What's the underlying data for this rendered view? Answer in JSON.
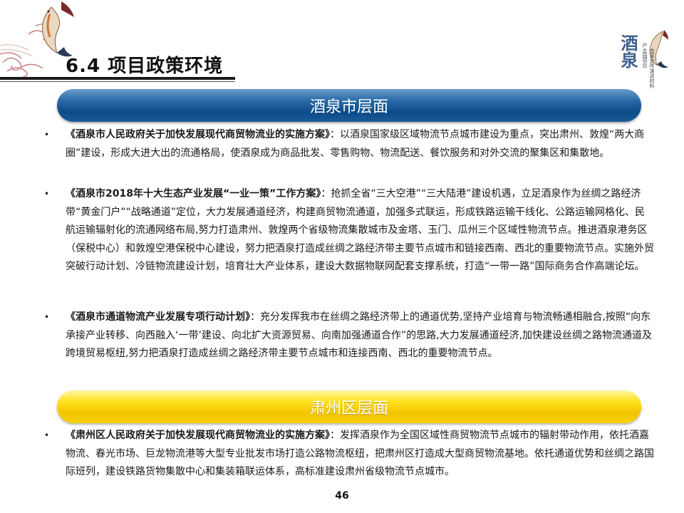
{
  "title": "6.4 项目政策环境",
  "logo": {
    "main": "酒泉",
    "sub_line1": "产业园项目",
    "sub_line2": "改革宣传演讲材料"
  },
  "section_city": "酒泉市层面",
  "section_district": "肃州区层面",
  "items": [
    {
      "head": "《酒泉市人民政府关于加快发展现代商贸物流业的实施方案》",
      "body": "：以酒泉国家级区域物流节点城市建设为重点，突出肃州、敦煌“两大商圈”建设，形成大进大出的流通格局，使酒泉成为商品批发、零售购物、物流配送、餐饮服务和对外交流的聚集区和集散地。"
    },
    {
      "head": "《酒泉市2018年十大生态产业发展“一业一策”工作方案》",
      "body": "：抢抓全省“三大空港”“三大陆港”建设机遇，立足酒泉作为丝绸之路经济带“黄金门户”“战略通道”定位，大力发展通道经济，构建商贸物流通道，加强多式联运，形成铁路运输干线化、公路运输网格化、民航运输辐射化的流通网络布局,努力打造肃州、敦煌两个省级物流集散城市及金塔、玉门、瓜州三个区域性物流节点。推进酒泉港务区（保税中心）和敦煌空港保税中心建设，努力把酒泉打造成丝绸之路经济带主要节点城市和链接西南、西北的重要物流节点。实施外贸突破行动计划、冷链物流建设计划，培育壮大产业体系，建设大数据物联网配套支撑系统，打造“一带一路”国际商务合作高端论坛。"
    },
    {
      "head": "《酒泉市通道物流产业发展专项行动计划》",
      "body": "：充分发挥我市在丝绸之路经济带上的通道优势,坚持产业培育与物流畅通相融合,按照“向东承接产业转移、向西融入‘一带’建设、向北扩大资源贸易、向南加强通道合作”的思路,大力发展通道经济,加快建设丝绸之路物流通道及跨境贸易枢纽,努力把酒泉打造成丝绸之路经济带主要节点城市和连接西南、西北的重要物流节点。"
    },
    {
      "head": "《肃州区人民政府关于加快发展现代商贸物流业的实施方案》",
      "body": "：发挥酒泉作为全国区域性商贸物流节点城市的辐射带动作用，依托酒嘉物流、春光市场、巨龙物流港等大型专业批发市场打造公路物流枢纽，把肃州区打造成大型商贸物流基地。依托通道优势和丝绸之路国际班列，建设铁路货物集散中心和集装箱联运体系，高标准建设肃州省级物流节点城市。"
    }
  ],
  "bullet_char": "•",
  "page_number": "46",
  "colors": {
    "banner_blue": "#0d4a86",
    "banner_yellow": "#f2c400",
    "logo_blue": "#3f5f8e"
  }
}
